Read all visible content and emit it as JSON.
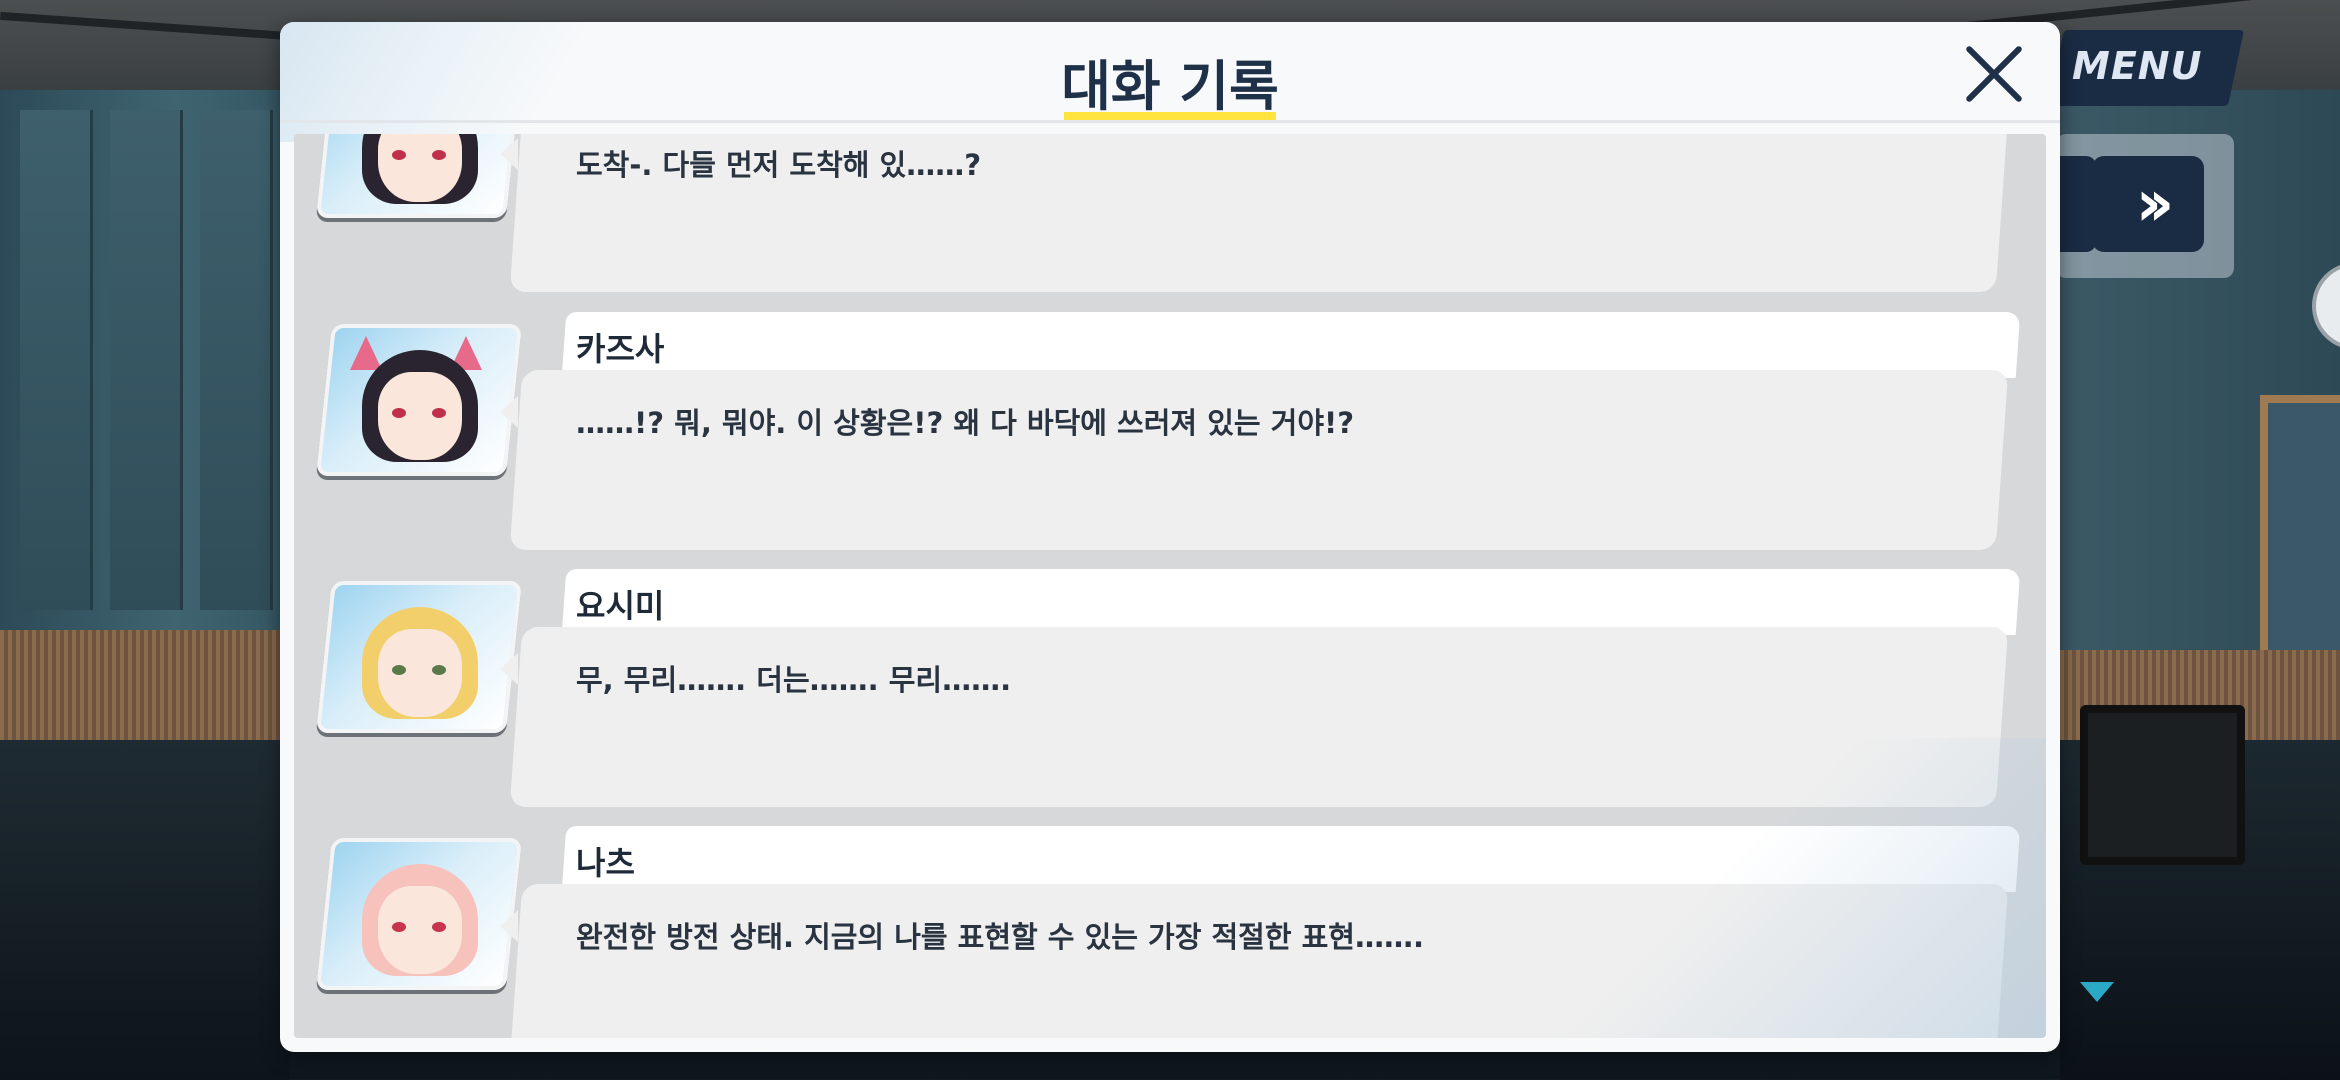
{
  "header": {
    "title": "대화 기록"
  },
  "controls": {
    "menu_label": "MENU",
    "skip_icon": "double-chevron-right-icon"
  },
  "colors": {
    "accent_underline": "#ffe33f",
    "navy": "#1a2c44",
    "title_text": "#1f3148"
  },
  "log": [
    {
      "speaker": "",
      "text": "도착-. 다들 먼저 도착해 있……?"
    },
    {
      "speaker": "카즈사",
      "text": "……!? 뭐, 뭐야. 이 상황은!? 왜 다 바닥에 쓰러져 있는 거야!?"
    },
    {
      "speaker": "요시미",
      "text": "무, 무리……. 더는……. 무리……."
    },
    {
      "speaker": "나츠",
      "text": "완전한 방전 상태. 지금의 나를 표현할 수 있는 가장 적절한 표현……."
    }
  ]
}
